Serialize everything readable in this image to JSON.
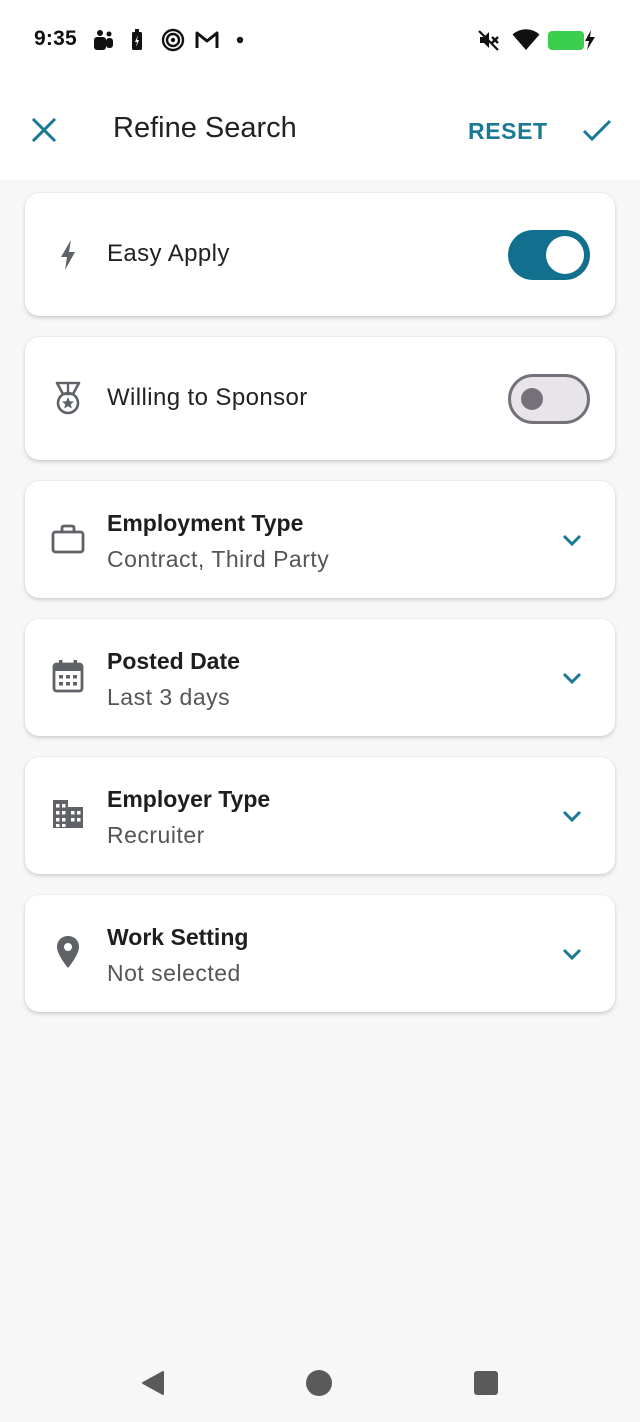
{
  "status_bar": {
    "time": "9:35",
    "left_icons": [
      "teams-icon",
      "battery-saver-icon",
      "spiral-app-icon",
      "gmail-icon",
      "notification-dot-icon"
    ],
    "right_icons": [
      "mute-icon",
      "wifi-icon",
      "battery-charging-icon"
    ],
    "battery_color": "#3ccf4e"
  },
  "app_bar": {
    "title": "Refine Search",
    "reset_label": "RESET",
    "accent_color": "#1a7a95"
  },
  "filters": {
    "easy_apply": {
      "label": "Easy Apply",
      "icon": "lightning-icon",
      "enabled": true
    },
    "willing_to_sponsor": {
      "label": "Willing to Sponsor",
      "icon": "medal-icon",
      "enabled": false
    },
    "employment_type": {
      "title": "Employment Type",
      "value": "Contract, Third Party",
      "icon": "briefcase-icon"
    },
    "posted_date": {
      "title": "Posted Date",
      "value": "Last 3 days",
      "icon": "calendar-icon"
    },
    "employer_type": {
      "title": "Employer Type",
      "value": "Recruiter",
      "icon": "building-icon"
    },
    "work_setting": {
      "title": "Work Setting",
      "value": "Not selected",
      "icon": "location-pin-icon"
    }
  },
  "nav_bar": {
    "buttons": [
      "back-icon",
      "home-icon",
      "recents-icon"
    ]
  }
}
